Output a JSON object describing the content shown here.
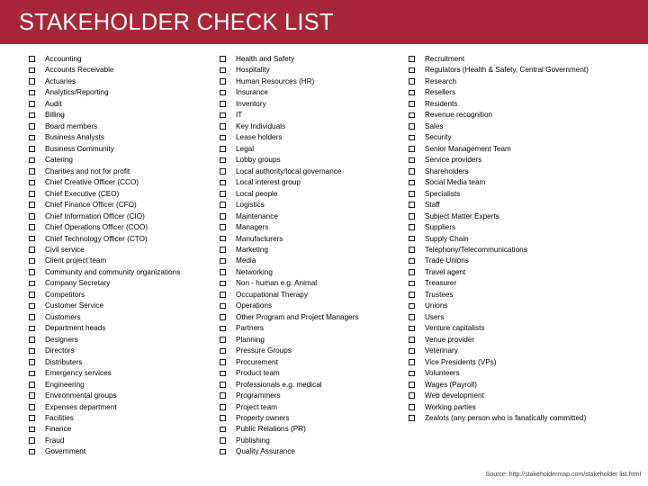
{
  "header": {
    "title": "STAKEHOLDER CHECK LIST",
    "background_color": "#A72638",
    "text_color": "#FFFFFF"
  },
  "checkbox": {
    "glyph": "checkbox-empty-square",
    "color": "#1A1A1A"
  },
  "columns": [
    {
      "id": "column-1",
      "items": [
        "Accounting",
        "Accounts Receivable",
        "Actuaries",
        "Analytics/Reporting",
        "Audit",
        "Billing",
        "Board members",
        "Business Analysts",
        "Business Community",
        "Catering",
        "Charities and not for profit",
        "Chief Creative Officer (CCO)",
        "Chief Executive (CEO)",
        "Chief Finance Officer (CFO)",
        "Chief Information Officer (CIO)",
        "Chief Operations Officer (COO)",
        "Chief Technology Officer (CTO)",
        "Civil service",
        "Client project team",
        "Community and community organizations",
        "Company Secretary",
        "Competitors",
        "Customer Service",
        "Customers",
        "Department heads",
        "Designers",
        "Directors",
        "Distributers",
        "Emergency services",
        "Engineering",
        "Environmental groups",
        "Expenses department",
        "Facilities",
        "Finance",
        "Fraud",
        "Government"
      ]
    },
    {
      "id": "column-2",
      "items": [
        "Health and Safety",
        "Hospitality",
        "Human Resources (HR)",
        "Insurance",
        "Inventory",
        "IT",
        "Key Individuals",
        "Lease holders",
        "Legal",
        "Lobby groups",
        "Local authority/local governance",
        "Local interest group",
        "Local people",
        "Logistics",
        "Maintenance",
        "Managers",
        "Manufacturers",
        "Marketing",
        "Media",
        "Networking",
        "Non - human e.g. Animal",
        "Occupational Therapy",
        "Operations",
        "Other Program and Project Managers",
        "Partners",
        "Planning",
        "Pressure Groups",
        "Procurement",
        "Product team",
        "Professionals e.g. medical",
        "Programmers",
        "Project team",
        "Property owners",
        "Public Relations (PR)",
        "Publishing",
        "Quality Assurance"
      ]
    },
    {
      "id": "column-3",
      "items": [
        "Recruitment",
        "Regulators (Health & Safety, Central Government)",
        "Research",
        "Resellers",
        "Residents",
        "Revenue recognition",
        "Sales",
        "Security",
        "Senior Management Team",
        "Service providers",
        "Shareholders",
        "Social Media team",
        "Specialists",
        "Staff",
        "Subject Matter Experts",
        "Suppliers",
        "Supply Chain",
        "Telephony/Telecommunications",
        "Trade Unions",
        "Travel agent",
        "Treasurer",
        "Trustees",
        "Unions",
        "Users",
        "Venture capitalists",
        "Venue provider",
        "Veterinary",
        "Vice Presidents (VPs)",
        "Volunteers",
        "Wages (Payroll)",
        "Web development",
        "Working parties",
        "Zealots (any person who is fanatically committed)"
      ]
    }
  ],
  "footer": {
    "source": "Source: http://stakeholdermap.com/stakeholder list.html"
  }
}
